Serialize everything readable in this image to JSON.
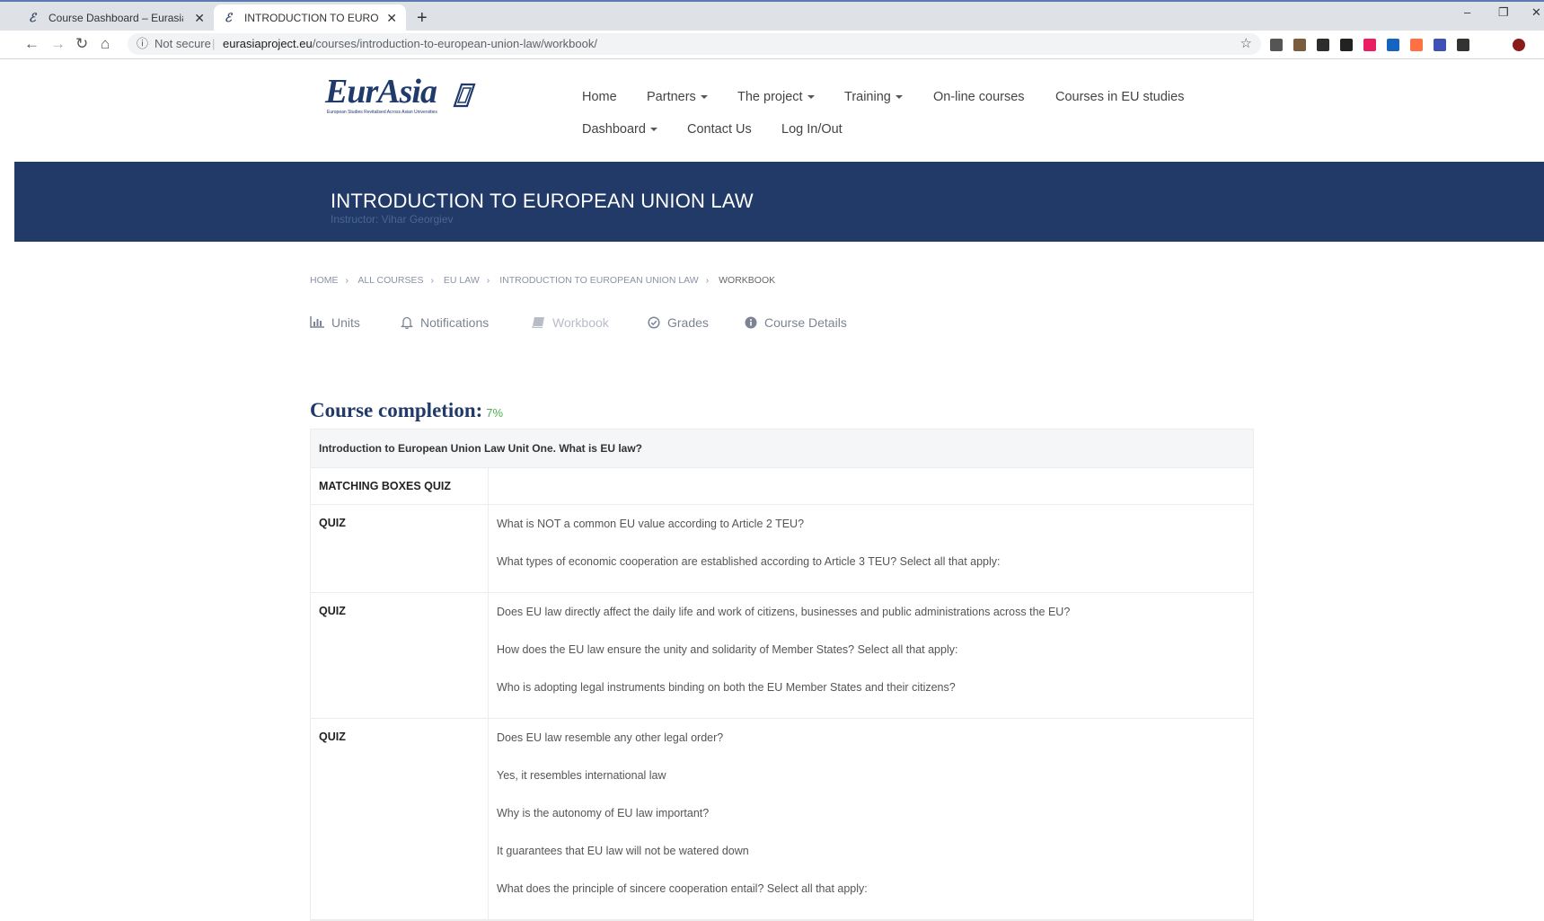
{
  "browser": {
    "tabs": [
      {
        "title": "Course Dashboard – Eurasia",
        "active": false
      },
      {
        "title": "INTRODUCTION TO EUROPEAN",
        "active": true
      }
    ],
    "new_tab": "+",
    "minimize": "–",
    "restore": "❐",
    "close": "✕",
    "not_secure": "Not secure",
    "url_domain": "eurasiaproject.eu",
    "url_path": "/courses/introduction-to-european-union-law/workbook/",
    "extension_colors": [
      "#555555",
      "#7a5c3e",
      "#2d2d2d",
      "#222222",
      "#e91e63",
      "#1565c0",
      "#ff7043",
      "#3f51b5",
      "#333333",
      "#8b1a1a"
    ]
  },
  "site": {
    "logo_text": "EurAsia",
    "logo_sub": "European Studies Revitalised Across Asian Universities",
    "nav": [
      {
        "label": "Home",
        "dropdown": false
      },
      {
        "label": "Partners",
        "dropdown": true
      },
      {
        "label": "The project",
        "dropdown": true
      },
      {
        "label": "Training",
        "dropdown": true
      },
      {
        "label": "On-line courses",
        "dropdown": false
      },
      {
        "label": "Courses in EU studies",
        "dropdown": false
      },
      {
        "label": "Dashboard",
        "dropdown": true
      },
      {
        "label": "Contact Us",
        "dropdown": false
      },
      {
        "label": "Log In/Out",
        "dropdown": false
      }
    ]
  },
  "banner": {
    "title": "INTRODUCTION TO EUROPEAN UNION LAW",
    "instructor": "Instructor: Vihar Georgiev",
    "background": "#213a68"
  },
  "breadcrumb": [
    "HOME",
    "ALL COURSES",
    "EU LAW",
    "INTRODUCTION TO EUROPEAN UNION LAW",
    "WORKBOOK"
  ],
  "course_tabs": [
    {
      "label": "Units",
      "icon": "bar-chart-icon"
    },
    {
      "label": "Notifications",
      "icon": "bell-icon"
    },
    {
      "label": "Workbook",
      "icon": "book-icon"
    },
    {
      "label": "Grades",
      "icon": "check-circle-icon"
    },
    {
      "label": "Course Details",
      "icon": "info-icon"
    }
  ],
  "completion": {
    "label": "Course completion:",
    "percent": "7%"
  },
  "workbook": {
    "unit_title": "Introduction to European Union Law Unit One. What is EU law?",
    "rows": [
      {
        "type": "MATCHING BOXES QUIZ",
        "questions": []
      },
      {
        "type": "QUIZ",
        "questions": [
          "What is NOT a common EU value according to Article 2 TEU?",
          "What types of economic cooperation are established according to Article 3 TEU? Select all that apply:"
        ]
      },
      {
        "type": "QUIZ",
        "questions": [
          "Does EU law directly affect the daily life and work of citizens, businesses and public administrations across the EU?",
          "How does the EU law ensure the unity and solidarity of Member States? Select all that apply:",
          "Who is adopting legal instruments binding on both the EU Member States and their citizens?"
        ]
      },
      {
        "type": "QUIZ",
        "questions": [
          "Does EU law resemble any other legal order?",
          "Yes, it resembles international law",
          "Why is the autonomy of EU law important?",
          "It guarantees that EU law will not be watered down",
          "What does the principle of sincere cooperation entail? Select all that apply:"
        ]
      }
    ]
  }
}
